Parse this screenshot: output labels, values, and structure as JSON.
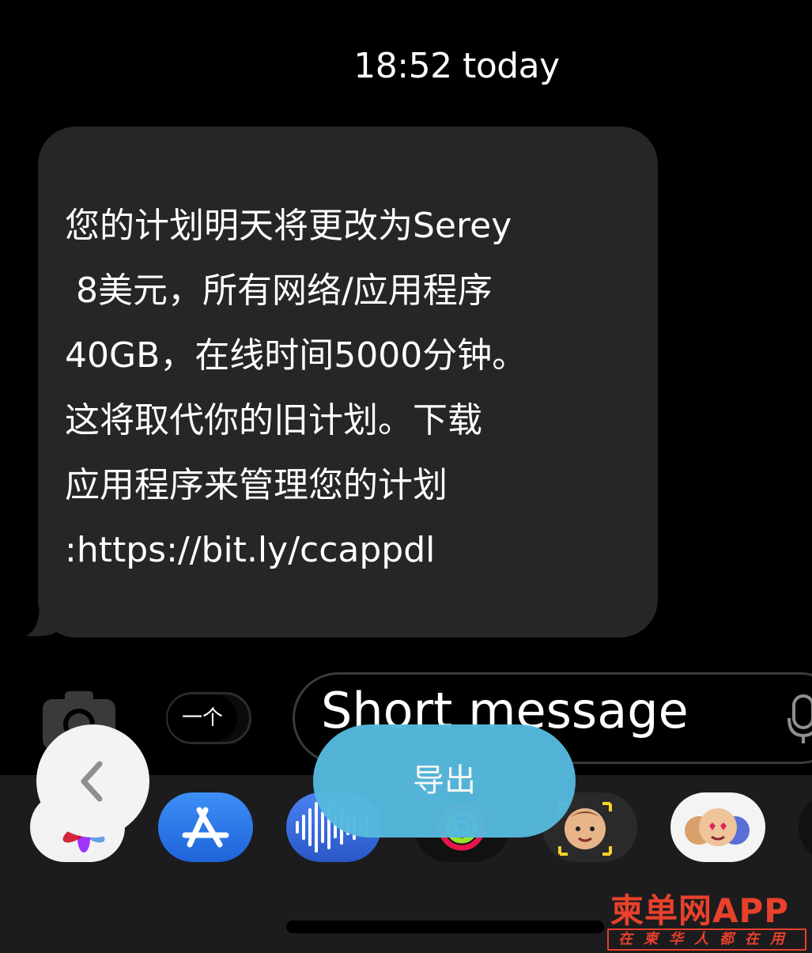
{
  "thread": {
    "timestamp": "18:52 today",
    "message": "您的计划明天将更改为Serey\n 8美元，所有网络/应用程序\n40GB，在线时间5000分钟。\n这将取代你的旧计划。下载\n应用程序来管理您的计划\n:https://bit.ly/ccappdl"
  },
  "composer": {
    "apps_pill_label": "一个",
    "input_placeholder": "Short message"
  },
  "overlay": {
    "export_label": "导出"
  },
  "icons": {
    "camera": "camera-icon",
    "mic": "microphone-icon",
    "back": "chevron-left-icon",
    "photos": "photos-app-icon",
    "appstore": "app-store-icon",
    "soundwave": "audio-message-icon",
    "activity": "activity-app-icon",
    "memoji_cam": "memoji-camera-icon",
    "memoji": "memoji-stickers-icon"
  },
  "watermark": {
    "title": "柬单网APP",
    "subtitle": "在柬华人都在用"
  },
  "colors": {
    "bubble": "#262628",
    "export": "#56b9dd",
    "watermark": "#e8412c"
  }
}
